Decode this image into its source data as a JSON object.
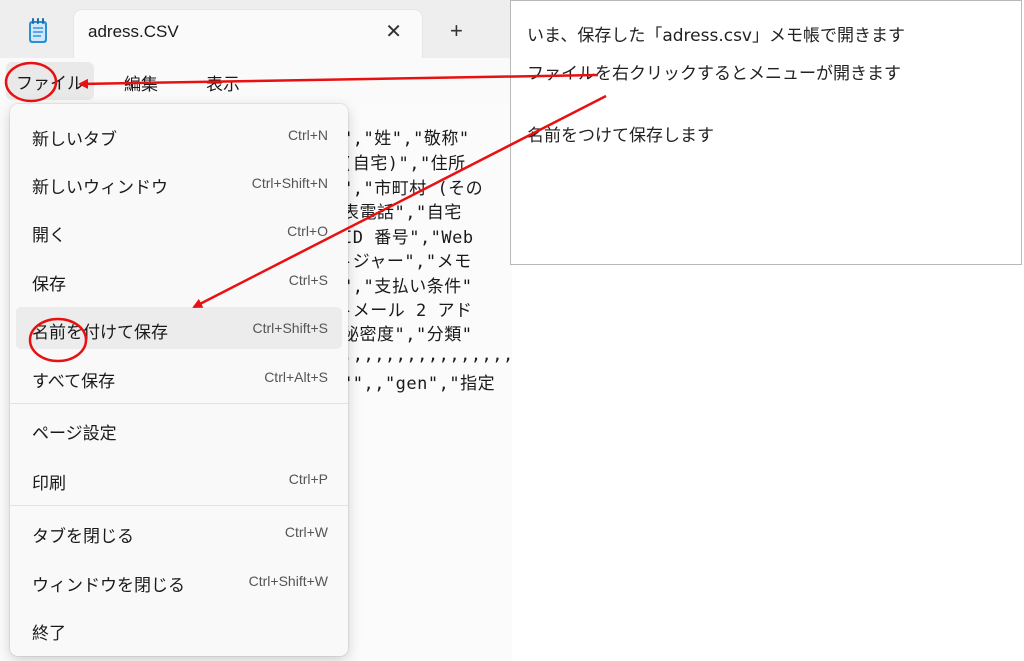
{
  "window": {
    "app_icon": "notepad-icon",
    "tab_title": "adress.CSV",
    "tab_close": "✕",
    "new_tab": "+"
  },
  "menubar": {
    "file": "ファイル",
    "edit": "編集",
    "view": "表示"
  },
  "editor": {
    "lines": [
      "\",\"姓\",\"敬称\"",
      "(自宅)\",\"住所",
      "\",\"市町村 (その",
      "表電話\",\"自宅",
      "ID 番号\",\"Web",
      "-ジャー\",\"メモ",
      "\",\"支払い条件\"",
      "-メール 2 アド",
      "秘密度\",\"分類\"",
      ",,,,,,,,,,,,,,,,",
      "\"\",,\"gen\",\"指定"
    ]
  },
  "file_menu": {
    "items": [
      {
        "label": "新しいタブ",
        "shortcut": "Ctrl+N"
      },
      {
        "label": "新しいウィンドウ",
        "shortcut": "Ctrl+Shift+N"
      },
      {
        "label": "開く",
        "shortcut": "Ctrl+O"
      },
      {
        "label": "保存",
        "shortcut": "Ctrl+S"
      },
      {
        "label": "名前を付けて保存",
        "shortcut": "Ctrl+Shift+S"
      },
      {
        "label": "すべて保存",
        "shortcut": "Ctrl+Alt+S"
      },
      {
        "label": "ページ設定",
        "shortcut": ""
      },
      {
        "label": "印刷",
        "shortcut": "Ctrl+P"
      },
      {
        "label": "タブを閉じる",
        "shortcut": "Ctrl+W"
      },
      {
        "label": "ウィンドウを閉じる",
        "shortcut": "Ctrl+Shift+W"
      },
      {
        "label": "終了",
        "shortcut": ""
      }
    ],
    "highlighted_item": "名前を付けて保存"
  },
  "annotation": {
    "lines": [
      "いま、保存した「adress.csv」メモ帳で開きます",
      "ファイルを右クリックするとメニューが開きます",
      "名前をつけて保存します"
    ],
    "marker_color": "#e81010"
  }
}
